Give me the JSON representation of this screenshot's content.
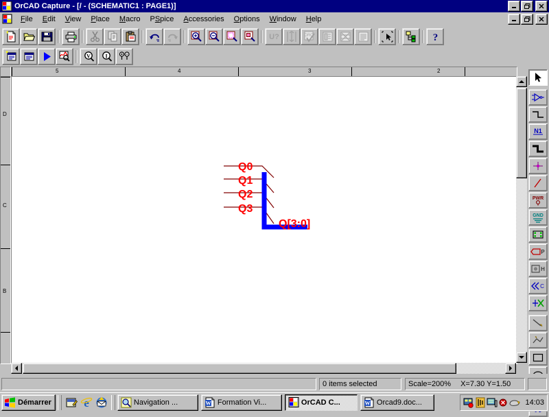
{
  "window": {
    "title": "OrCAD Capture - [/ - (SCHEMATIC1 : PAGE1)]",
    "icon": "orcad-capture-icon",
    "minimize_label": "_",
    "maximize_label": "□",
    "close_label": "✕"
  },
  "mdi": {
    "icon": "document-icon",
    "minimize_label": "_",
    "restore_label": "□",
    "close_label": "✕"
  },
  "menu": [
    {
      "label": "File",
      "accel": "F"
    },
    {
      "label": "Edit",
      "accel": "E"
    },
    {
      "label": "View",
      "accel": "V"
    },
    {
      "label": "Place",
      "accel": "P"
    },
    {
      "label": "Macro",
      "accel": "M"
    },
    {
      "label": "PSpice",
      "accel": "S"
    },
    {
      "label": "Accessories",
      "accel": "A"
    },
    {
      "label": "Options",
      "accel": "O"
    },
    {
      "label": "Window",
      "accel": "W"
    },
    {
      "label": "Help",
      "accel": "H"
    }
  ],
  "toolbar_main": [
    {
      "name": "new-icon",
      "title": "New",
      "enabled": true
    },
    {
      "name": "open-icon",
      "title": "Open",
      "enabled": true
    },
    {
      "name": "save-icon",
      "title": "Save",
      "enabled": true
    },
    {
      "name": "separator",
      "title": "",
      "enabled": true
    },
    {
      "name": "print-icon",
      "title": "Print",
      "enabled": true
    },
    {
      "name": "separator",
      "title": "",
      "enabled": true
    },
    {
      "name": "cut-icon",
      "title": "Cut",
      "enabled": false
    },
    {
      "name": "copy-icon",
      "title": "Copy",
      "enabled": false
    },
    {
      "name": "paste-icon",
      "title": "Paste",
      "enabled": false
    },
    {
      "name": "separator",
      "title": "",
      "enabled": true
    },
    {
      "name": "undo-icon",
      "title": "Undo",
      "enabled": true
    },
    {
      "name": "redo-icon",
      "title": "Redo",
      "enabled": false
    },
    {
      "name": "separator",
      "title": "",
      "enabled": true
    },
    {
      "name": "zoom-in-icon",
      "title": "Zoom In",
      "enabled": true
    },
    {
      "name": "zoom-out-icon",
      "title": "Zoom Out",
      "enabled": true
    },
    {
      "name": "zoom-area-icon",
      "title": "Zoom Area",
      "enabled": true
    },
    {
      "name": "zoom-all-icon",
      "title": "Zoom All",
      "enabled": true
    },
    {
      "name": "separator",
      "title": "",
      "enabled": true
    },
    {
      "name": "annotate-icon",
      "title": "Annotate",
      "enabled": false
    },
    {
      "name": "backannotate-icon",
      "title": "Back Annotate",
      "enabled": false
    },
    {
      "name": "drc-icon",
      "title": "Design Rules Check",
      "enabled": false
    },
    {
      "name": "netlist-icon",
      "title": "Create Netlist",
      "enabled": false
    },
    {
      "name": "crossref-icon",
      "title": "Cross Reference Parts",
      "enabled": false
    },
    {
      "name": "bom-icon",
      "title": "Bill of Materials",
      "enabled": false
    },
    {
      "name": "separator",
      "title": "",
      "enabled": true
    },
    {
      "name": "snap-icon",
      "title": "Snap to Grid",
      "enabled": true
    },
    {
      "name": "separator",
      "title": "",
      "enabled": true
    },
    {
      "name": "project-manager-icon",
      "title": "Project Manager",
      "enabled": true
    },
    {
      "name": "separator",
      "title": "",
      "enabled": true
    },
    {
      "name": "help-icon",
      "title": "Help",
      "enabled": true
    }
  ],
  "toolbar_pspice": [
    {
      "name": "new-simulation-icon",
      "title": "New Simulation Profile",
      "enabled": true
    },
    {
      "name": "edit-simulation-icon",
      "title": "Edit Simulation Profile",
      "enabled": true
    },
    {
      "name": "run-icon",
      "title": "Run",
      "enabled": true
    },
    {
      "name": "view-results-icon",
      "title": "View Simulation Results",
      "enabled": true
    },
    {
      "name": "separator",
      "title": "",
      "enabled": true
    },
    {
      "name": "voltage-marker-icon",
      "title": "Voltage/Level Marker",
      "enabled": true
    },
    {
      "name": "current-marker-icon",
      "title": "Current Marker",
      "enabled": true
    },
    {
      "name": "diff-marker-icon",
      "title": "Voltage Differential Markers",
      "enabled": true
    }
  ],
  "palette": [
    {
      "name": "select-tool",
      "title": "Select",
      "glyph": "cursor",
      "active": true
    },
    {
      "name": "place-part-tool",
      "title": "Place Part",
      "glyph": "part",
      "active": false
    },
    {
      "name": "place-wire-tool",
      "title": "Place Wire",
      "glyph": "wire",
      "active": false
    },
    {
      "name": "place-net-alias-tool",
      "title": "Place Net Alias",
      "glyph": "N1",
      "active": false
    },
    {
      "name": "place-bus-tool",
      "title": "Place Bus",
      "glyph": "bus",
      "active": false
    },
    {
      "name": "place-junction-tool",
      "title": "Place Junction",
      "glyph": "junction",
      "active": false
    },
    {
      "name": "place-bus-entry-tool",
      "title": "Place Bus Entry",
      "glyph": "busentry",
      "active": false
    },
    {
      "name": "place-power-tool",
      "title": "Place Power",
      "glyph": "PWR",
      "active": false
    },
    {
      "name": "place-ground-tool",
      "title": "Place Ground",
      "glyph": "GND",
      "active": false
    },
    {
      "name": "place-hier-block-tool",
      "title": "Place Hierarchical Block",
      "glyph": "hblock",
      "active": false
    },
    {
      "name": "place-hier-port-tool",
      "title": "Place Hierarchical Port",
      "glyph": "P",
      "active": false
    },
    {
      "name": "place-hier-pin-tool",
      "title": "Place Hierarchical Pin",
      "glyph": "H",
      "active": false
    },
    {
      "name": "place-offpage-tool",
      "title": "Place Off-Page Connector",
      "glyph": "C",
      "active": false
    },
    {
      "name": "place-nc-tool",
      "title": "Place No Connect",
      "glyph": "nc",
      "active": false
    },
    {
      "name": "place-line-tool",
      "title": "Place Line",
      "glyph": "line",
      "active": false
    },
    {
      "name": "place-polyline-tool",
      "title": "Place Polyline",
      "glyph": "polyline",
      "active": false
    },
    {
      "name": "place-rectangle-tool",
      "title": "Place Rectangle",
      "glyph": "rect",
      "active": false
    },
    {
      "name": "place-ellipse-tool",
      "title": "Place Ellipse",
      "glyph": "ellipse",
      "active": false
    },
    {
      "name": "place-arc-tool",
      "title": "Place Arc",
      "glyph": "arc",
      "active": false
    },
    {
      "name": "place-text-tool",
      "title": "Place Text",
      "glyph": "A",
      "active": false
    }
  ],
  "ruler": {
    "horizontal_labels": [
      "5",
      "4",
      "3",
      "2"
    ],
    "vertical_labels": [
      "D",
      "C",
      "B"
    ]
  },
  "schematic": {
    "colors": {
      "bus": "#0000ff",
      "wire": "#800000",
      "label": "#ff0000",
      "page_background": "#ffffff"
    },
    "nets": [
      {
        "label": "Q0"
      },
      {
        "label": "Q1"
      },
      {
        "label": "Q2"
      },
      {
        "label": "Q3"
      }
    ],
    "bus_label": "Q[3:0]"
  },
  "statusbar": {
    "selection": "0 items selected",
    "scale": "Scale=200%",
    "coords": "X=7.30  Y=1.50"
  },
  "taskbar": {
    "start_label": "Démarrer",
    "quicklaunch": [
      {
        "name": "show-desktop-icon",
        "title": "Show Desktop"
      },
      {
        "name": "internet-explorer-icon",
        "title": "Internet Explorer"
      },
      {
        "name": "outlook-express-icon",
        "title": "Outlook Express"
      }
    ],
    "tasks": [
      {
        "label": "Navigation ...",
        "icon": "explorer-icon",
        "active": false
      },
      {
        "label": "Formation Vi...",
        "icon": "word-icon",
        "active": false
      },
      {
        "label": "OrCAD C...",
        "icon": "orcad-capture-icon",
        "active": true
      },
      {
        "label": "Orcad9.doc...",
        "icon": "word-icon",
        "active": false
      }
    ],
    "tray": [
      {
        "name": "modem-tray-icon"
      },
      {
        "name": "volume-tray-icon"
      },
      {
        "name": "network-tray-icon"
      },
      {
        "name": "mute-tray-icon"
      },
      {
        "name": "mouse-tray-icon"
      }
    ],
    "time": "14:03"
  }
}
